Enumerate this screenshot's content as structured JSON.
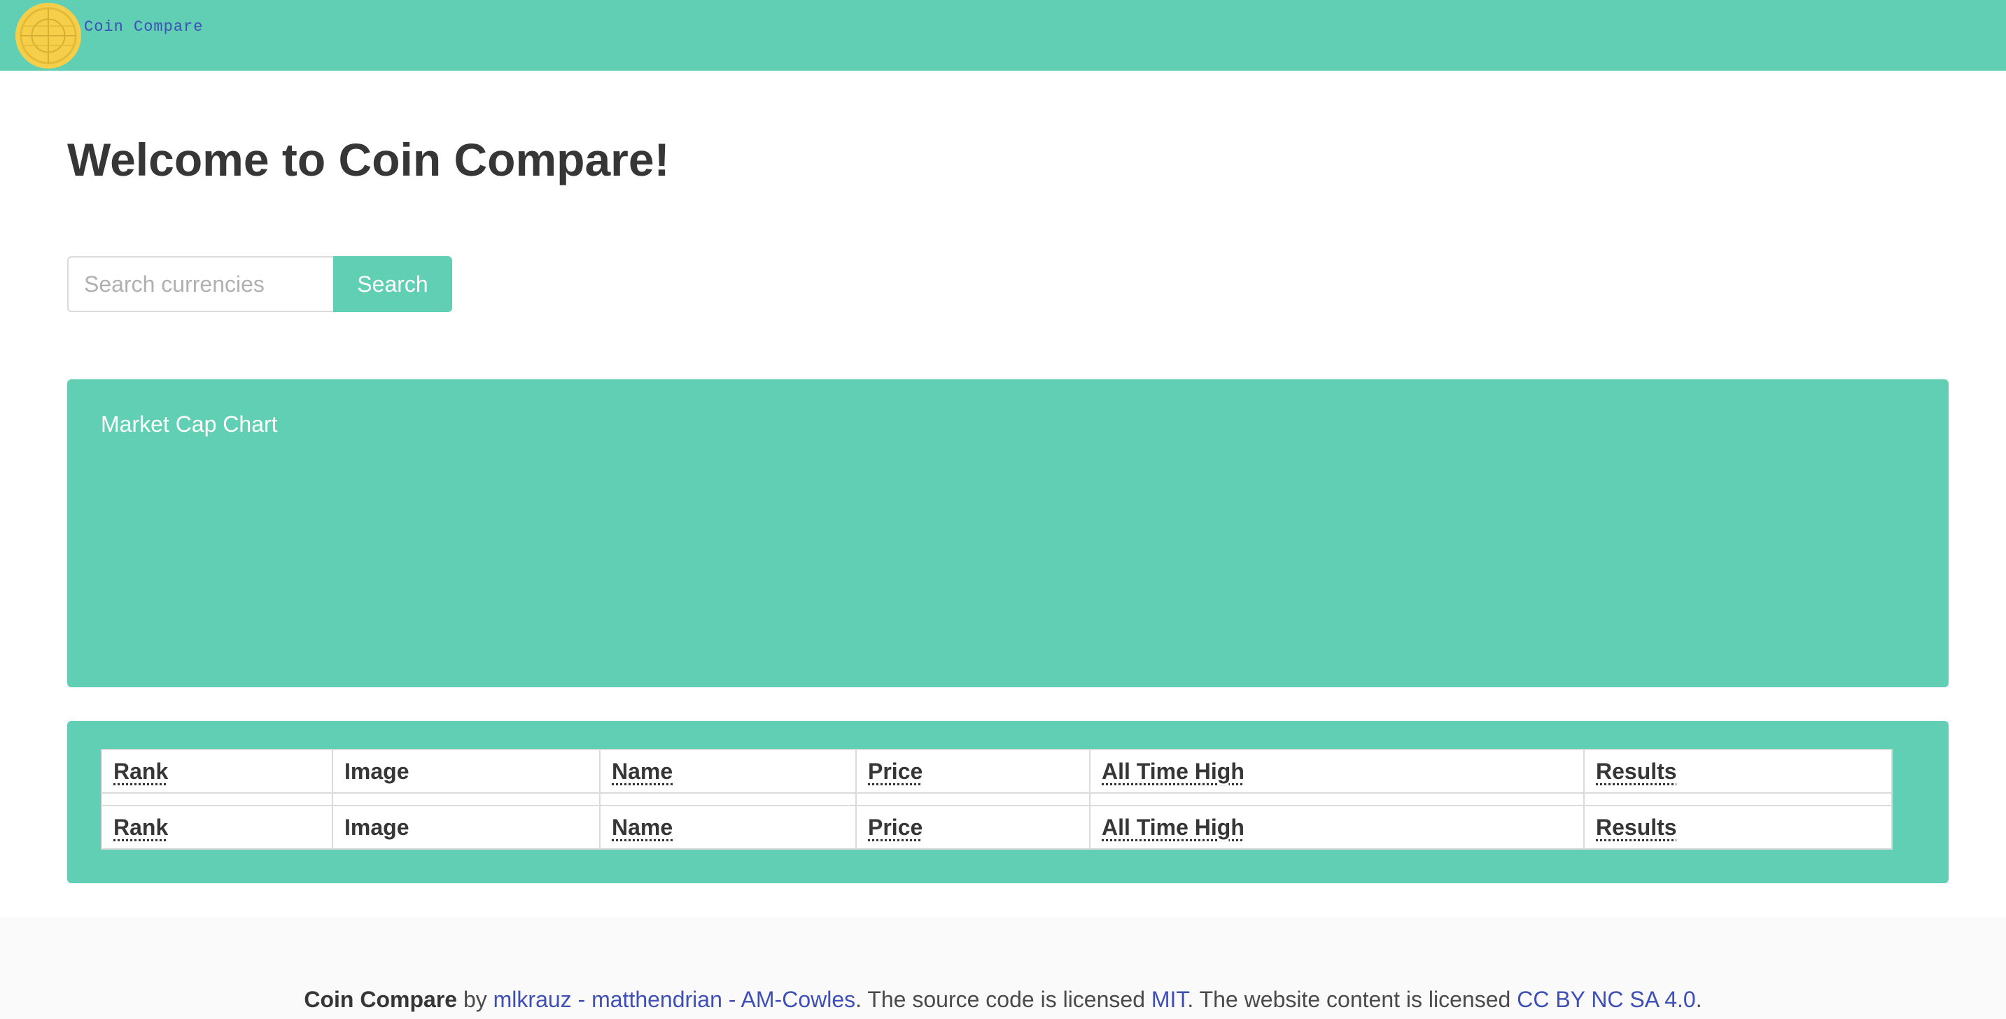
{
  "navbar": {
    "logo_icon": "coin-icon",
    "brand": "Coin Compare",
    "bg_color": "#61cfb3",
    "brand_color": "#3e4fb8"
  },
  "main": {
    "title": "Welcome to Coin Compare!",
    "search": {
      "placeholder": "Search currencies",
      "value": "",
      "button_label": "Search"
    },
    "chart": {
      "label": "Market Cap Chart"
    },
    "table": {
      "head": [
        "Rank",
        "Image",
        "Name",
        "Price",
        "All Time High",
        "Results"
      ],
      "foot": [
        "Rank",
        "Image",
        "Name",
        "Price",
        "All Time High",
        "Results"
      ]
    }
  },
  "footer": {
    "brand": "Coin Compare",
    "by": " by ",
    "authors": "mlkrauz - matthendrian - AM-Cowles",
    "source_text": ". The source code is licensed ",
    "source_license": "MIT",
    "content_text": ". The website content is licensed ",
    "content_license": "CC BY NC SA 4.0",
    "end": "."
  },
  "colors": {
    "accent": "#61cfb3",
    "link": "#3e4fb8",
    "text": "#363636"
  }
}
